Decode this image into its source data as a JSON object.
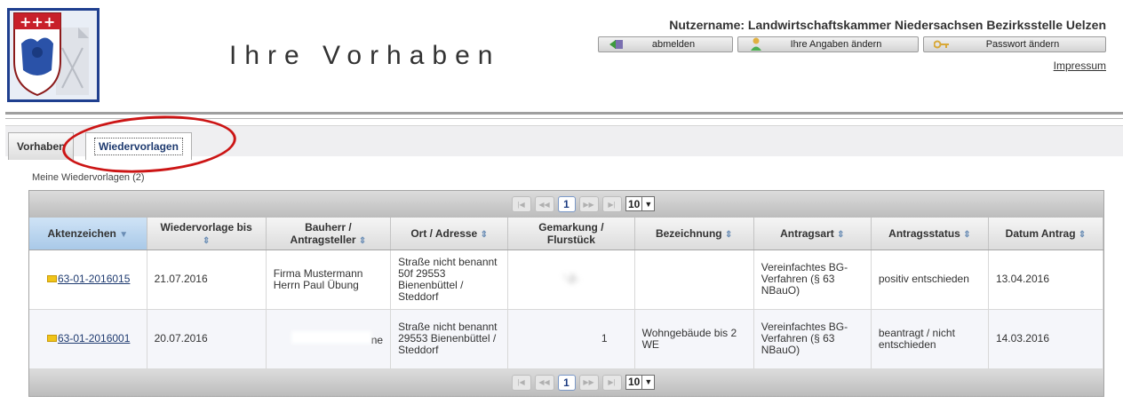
{
  "header": {
    "page_title": "Ihre Vorhaben",
    "username": "Nutzername: Landwirtschaftskammer Niedersachsen Bezirksstelle Uelzen",
    "buttons": {
      "logout": "abmelden",
      "change_profile": "Ihre Angaben ändern",
      "change_password": "Passwort ändern"
    },
    "impressum": "Impressum"
  },
  "tabs": [
    {
      "label": "Vorhaben",
      "active": false
    },
    {
      "label": "Wiedervorlagen",
      "active": true
    }
  ],
  "caption": "Meine Wiedervorlagen (2)",
  "pager": {
    "current_page": "1",
    "rows_per_page": "10",
    "first": "|◀",
    "prev": "◀◀",
    "next": "▶▶",
    "last": "▶|"
  },
  "table": {
    "columns": [
      {
        "label": "Aktenzeichen",
        "sort": "▼"
      },
      {
        "label": "Wiedervorlage bis",
        "sort": "⇕"
      },
      {
        "label": "Bauherr / Antragsteller",
        "sort": "⇕"
      },
      {
        "label": "Ort / Adresse",
        "sort": "⇕"
      },
      {
        "label": "Gemarkung / Flurstück",
        "sort": ""
      },
      {
        "label": "Bezeichnung",
        "sort": "⇕"
      },
      {
        "label": "Antragsart",
        "sort": "⇕"
      },
      {
        "label": "Antragsstatus",
        "sort": "⇕"
      },
      {
        "label": "Datum Antrag",
        "sort": "⇕"
      }
    ],
    "rows": [
      {
        "aktenzeichen": "63-01-2016015",
        "wiedervorlage": "21.07.2016",
        "bauherr": "Firma Mustermann Herrn Paul Übung",
        "ort": "Straße nicht benannt 50f 29553 Bienenbüttel / Steddorf",
        "gemarkung": "'-2-",
        "bezeichnung": "",
        "antragsart": "Vereinfachtes BG-Verfahren (§ 63 NBauO)",
        "status": "positiv entschieden",
        "datum": "13.04.2016"
      },
      {
        "aktenzeichen": "63-01-2016001",
        "wiedervorlage": "20.07.2016",
        "bauherr": "ne",
        "ort": "Straße nicht benannt 29553 Bienenbüttel / Steddorf",
        "gemarkung": "1",
        "bezeichnung": "Wohngebäude bis 2 WE",
        "antragsart": "Vereinfachtes BG-Verfahren (§ 63 NBauO)",
        "status": "beantragt / nicht entschieden",
        "datum": "14.03.2016"
      }
    ]
  }
}
